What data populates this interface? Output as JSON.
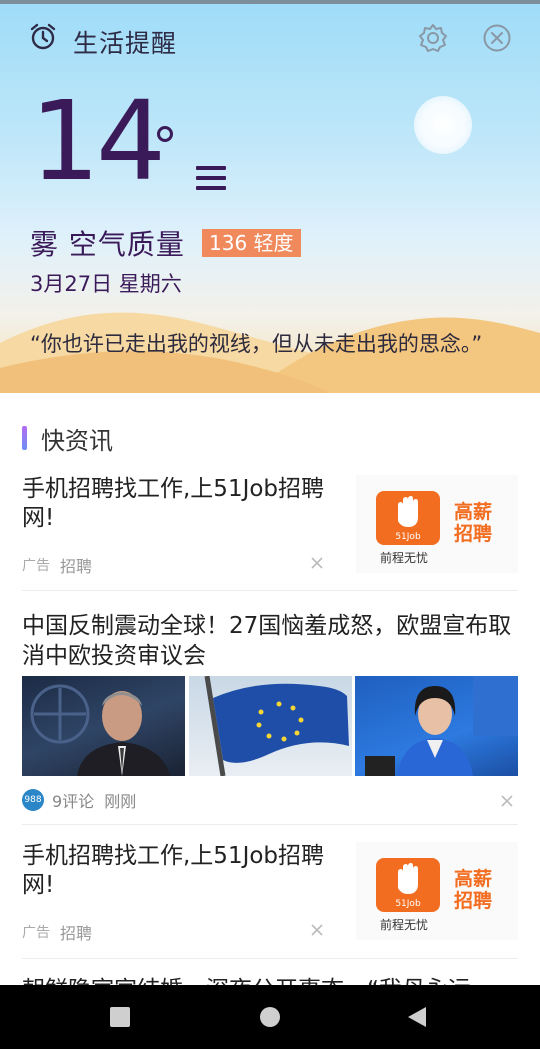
{
  "header": {
    "title": "生活提醒",
    "icons": [
      "alarm-clock-icon",
      "gear-icon",
      "close-circle-icon"
    ]
  },
  "weather": {
    "temperature": "14",
    "condition": "雾 空气质量",
    "aqi_badge": "136 轻度",
    "date": "3月27日 星期六",
    "quote": "“你也许已走出我的视线，但从未走出我的思念。”",
    "colors": {
      "text": "#3b1a5a",
      "aqi_badge": "#f08a5d"
    }
  },
  "feed": {
    "section_title": "快资讯",
    "items": [
      {
        "type": "ad",
        "title": "手机招聘找工作,上51Job招聘网!",
        "tag": "广告",
        "source": "招聘",
        "banner": {
          "logo_text": "51Job",
          "slogan": "前程无忧",
          "highlight_1": "高薪",
          "highlight_2": "招聘"
        }
      },
      {
        "type": "news",
        "title": "中国反制震动全球！27国恼羞成怒，欧盟宣布取消中欧投资审议会",
        "source_icon": "988",
        "comments": "9评论",
        "time": "刚刚"
      },
      {
        "type": "ad",
        "title": "手机招聘找工作,上51Job招聘网!",
        "tag": "广告",
        "source": "招聘",
        "banner": {
          "logo_text": "51Job",
          "slogan": "前程无忧",
          "highlight_1": "高薪",
          "highlight_2": "招聘"
        }
      },
      {
        "type": "news_partial",
        "title": "朝鲜隐室家结婚，深夜公开事态，“我母永远"
      }
    ]
  },
  "navbar": {
    "buttons": [
      "recent-apps-icon",
      "home-icon",
      "back-icon"
    ]
  }
}
